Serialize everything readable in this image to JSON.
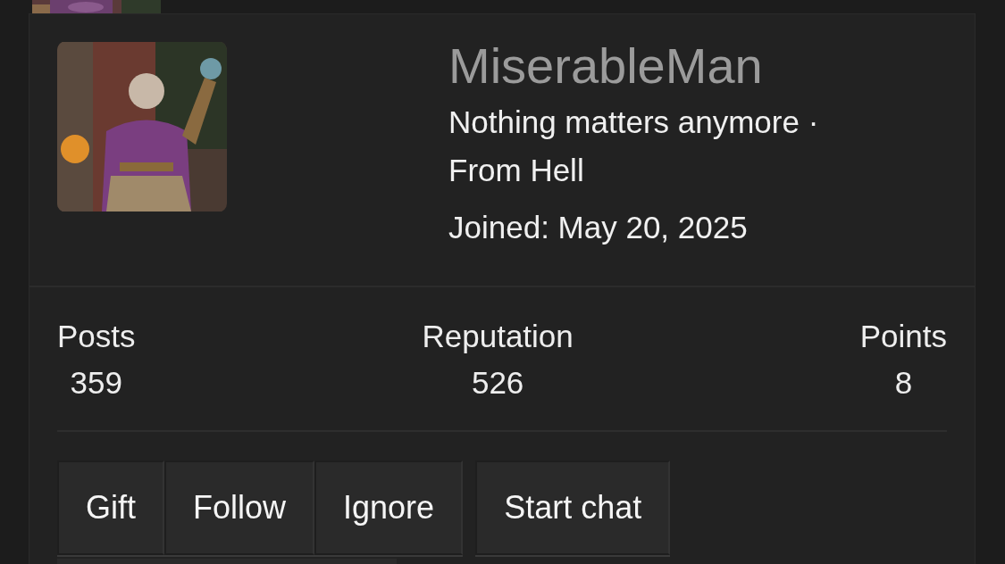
{
  "profile": {
    "username": "MiserableMan",
    "tagline": "Nothing matters anymore ·",
    "location": "From Hell",
    "joined": "Joined: May 20, 2025"
  },
  "stats": [
    {
      "label": "Posts",
      "value": "359"
    },
    {
      "label": "Reputation",
      "value": "526"
    },
    {
      "label": "Points",
      "value": "8"
    }
  ],
  "button_groups": [
    [
      "Gift",
      "Follow",
      "Ignore"
    ],
    [
      "Start chat"
    ]
  ]
}
